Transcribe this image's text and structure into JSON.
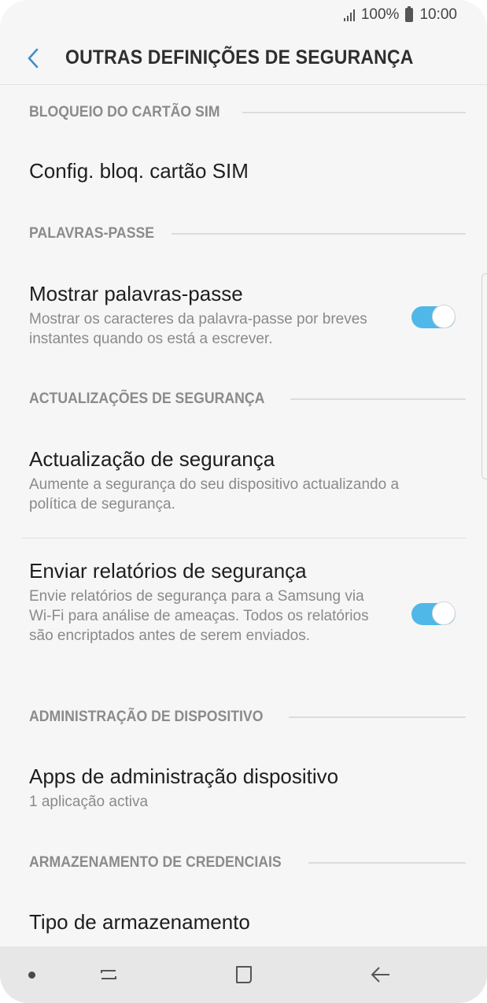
{
  "status_bar": {
    "battery": "100%",
    "time": "10:00"
  },
  "header": {
    "title": "OUTRAS DEFINIÇÕES DE SEGURANÇA",
    "back_icon": "chevron-left-icon"
  },
  "sections": {
    "sim": {
      "header": "BLOQUEIO DO CARTÃO SIM",
      "item_title": "Config. bloq. cartão SIM"
    },
    "passwords": {
      "header": "PALAVRAS-PASSE",
      "item_title": "Mostrar palavras-passe",
      "item_summary": "Mostrar os caracteres da palavra-passe por breves instantes quando os está a escrever.",
      "toggle_on": true
    },
    "updates": {
      "header": "ACTUALIZAÇÕES DE SEGURANÇA",
      "update_title": "Actualização de segurança",
      "update_summary": "Aumente a segurança do seu dispositivo actualizando a política de segurança.",
      "reports_title": "Enviar relatórios de segurança",
      "reports_summary": "Envie relatórios de segurança para a Samsung via Wi-Fi para análise de ameaças. Todos os relatórios são encriptados antes de serem enviados.",
      "reports_toggle_on": true
    },
    "device_admin": {
      "header": "ADMINISTRAÇÃO DE DISPOSITIVO",
      "item_title": "Apps de administração dispositivo",
      "item_summary": "1 aplicação activa"
    },
    "credentials": {
      "header": "ARMAZENAMENTO DE CREDENCIAIS",
      "item_title": "Tipo de armazenamento"
    }
  },
  "colors": {
    "accent": "#4fb8e8",
    "background": "#f6f6f6"
  },
  "nav_bar": {
    "icons": [
      "dot-icon",
      "recent-apps-icon",
      "home-icon",
      "back-arrow-icon"
    ]
  }
}
